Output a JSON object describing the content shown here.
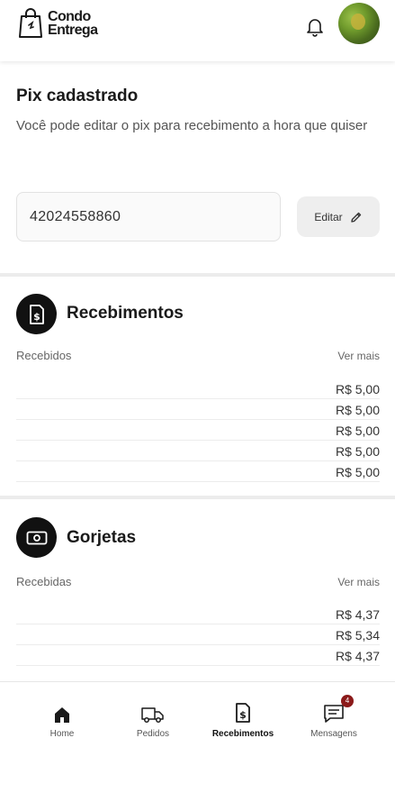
{
  "header": {
    "logo_line1": "Condo",
    "logo_line2": "Entrega"
  },
  "pix": {
    "title": "Pix cadastrado",
    "subtitle": "Você pode editar o pix para recebimento a hora que quiser",
    "value": "42024558860",
    "edit_label": "Editar"
  },
  "recebimentos": {
    "title": "Recebimentos",
    "list_label": "Recebidos",
    "see_more": "Ver mais",
    "items": [
      "R$ 5,00",
      "R$ 5,00",
      "R$ 5,00",
      "R$ 5,00",
      "R$ 5,00"
    ]
  },
  "gorjetas": {
    "title": "Gorjetas",
    "list_label": "Recebidas",
    "see_more": "Ver mais",
    "items": [
      "R$ 4,37",
      "R$ 5,34",
      "R$ 4,37"
    ]
  },
  "nav": {
    "items": [
      {
        "label": "Home",
        "icon": "home-icon"
      },
      {
        "label": "Pedidos",
        "icon": "truck-icon"
      },
      {
        "label": "Recebimentos",
        "icon": "receipt-icon",
        "active": true
      },
      {
        "label": "Mensagens",
        "icon": "message-icon",
        "badge": "4"
      }
    ]
  },
  "colors": {
    "accent": "#111111",
    "badge": "#8b1a1a",
    "divider": "#ececec"
  }
}
